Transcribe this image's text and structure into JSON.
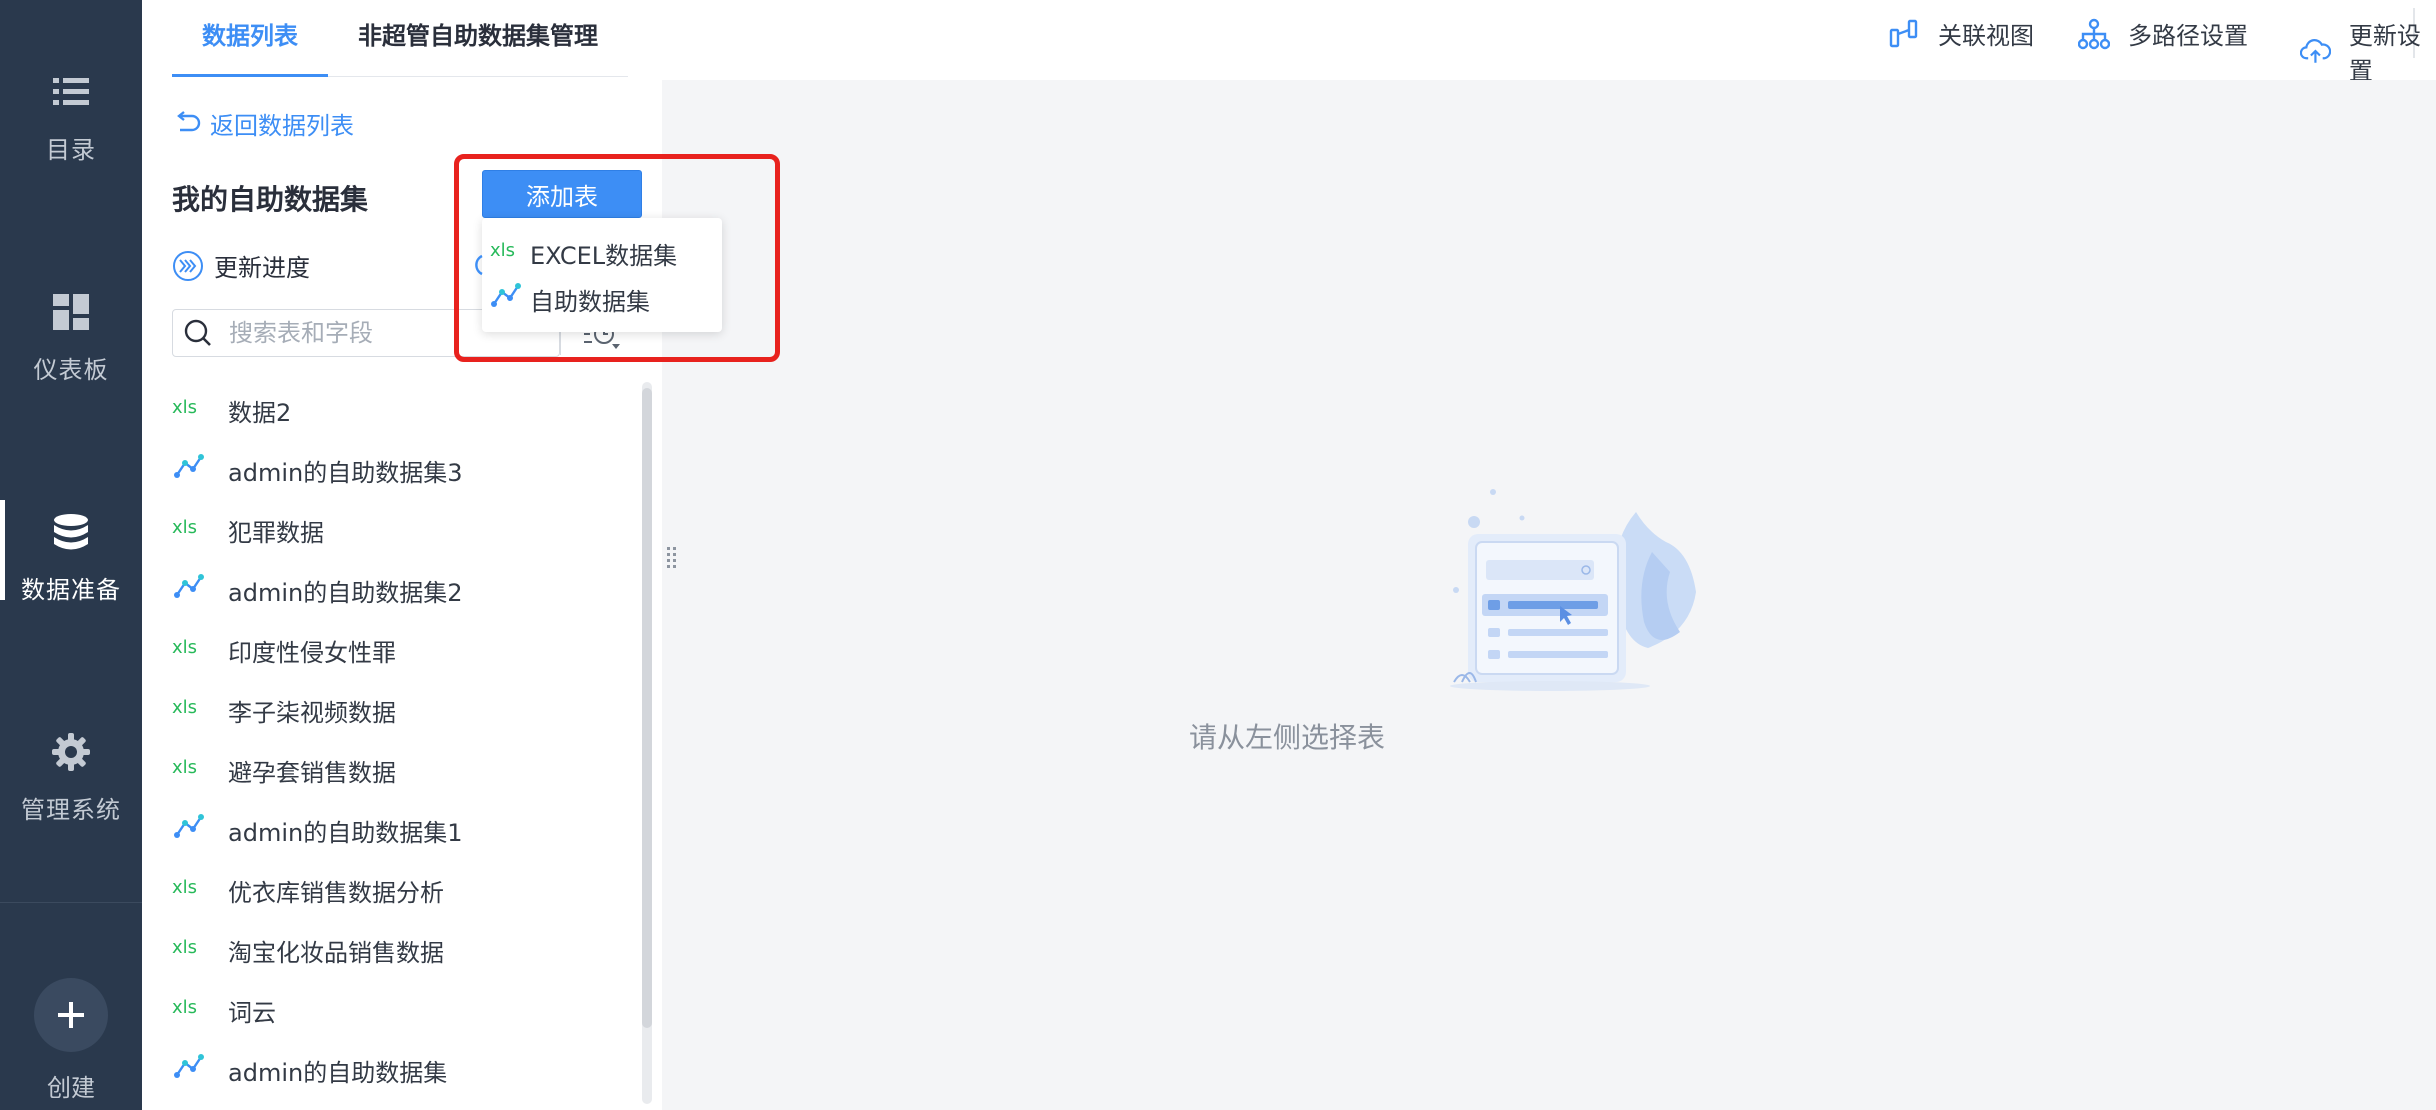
{
  "nav": {
    "items": [
      {
        "label": "目录",
        "icon": "list-icon"
      },
      {
        "label": "仪表板",
        "icon": "dashboard-icon"
      },
      {
        "label": "数据准备",
        "icon": "database-icon"
      },
      {
        "label": "管理系统",
        "icon": "gear-icon"
      }
    ],
    "create_label": "创建"
  },
  "topbar": {
    "tabs": [
      {
        "label": "数据列表",
        "active": true
      },
      {
        "label": "非超管自助数据集管理",
        "active": false
      }
    ],
    "tools": [
      {
        "label": "关联视图",
        "icon": "relation-view-icon"
      },
      {
        "label": "多路径设置",
        "icon": "multipath-icon"
      },
      {
        "label": "更新设置",
        "icon": "cloud-update-icon"
      }
    ]
  },
  "panel": {
    "back_label": "返回数据列表",
    "title": "我的自助数据集",
    "add_button": "添加表",
    "progress_label": "更新进度",
    "search_placeholder": "搜索表和字段",
    "items": [
      {
        "name": "数据2",
        "type": "excel"
      },
      {
        "name": "admin的自助数据集3",
        "type": "self"
      },
      {
        "name": "犯罪数据",
        "type": "excel"
      },
      {
        "name": "admin的自助数据集2",
        "type": "self"
      },
      {
        "name": "印度性侵女性罪",
        "type": "excel"
      },
      {
        "name": "李子柒视频数据",
        "type": "excel"
      },
      {
        "name": "避孕套销售数据",
        "type": "excel"
      },
      {
        "name": "admin的自助数据集1",
        "type": "self"
      },
      {
        "name": "优衣库销售数据分析",
        "type": "excel"
      },
      {
        "name": "淘宝化妆品销售数据",
        "type": "excel"
      },
      {
        "name": "词云",
        "type": "excel"
      },
      {
        "name": "admin的自助数据集",
        "type": "self"
      }
    ]
  },
  "dropdown": {
    "items": [
      {
        "label": "EXCEL数据集",
        "icon": "xls-icon"
      },
      {
        "label": "自助数据集",
        "icon": "self-dataset-icon"
      }
    ]
  },
  "main": {
    "empty_text": "请从左侧选择表"
  },
  "colors": {
    "nav_bg": "#2a394d",
    "accent": "#3d8ef5",
    "excel_green": "#27b95a",
    "highlight_red": "#e8221e",
    "main_bg": "#f4f5f7"
  }
}
